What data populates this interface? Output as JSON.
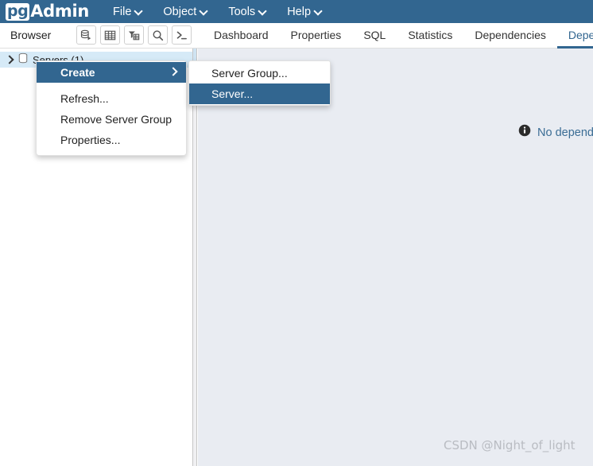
{
  "app": {
    "logo_pg": "pg",
    "logo_admin": "Admin"
  },
  "menubar": {
    "items": [
      {
        "label": "File",
        "icon": "chevron-down-icon"
      },
      {
        "label": "Object",
        "icon": "chevron-down-icon"
      },
      {
        "label": "Tools",
        "icon": "chevron-down-icon"
      },
      {
        "label": "Help",
        "icon": "chevron-down-icon"
      }
    ]
  },
  "browser_toolbar": {
    "title": "Browser",
    "buttons": [
      {
        "name": "object-explorer-icon"
      },
      {
        "name": "grid-table-icon"
      },
      {
        "name": "filter-table-icon"
      },
      {
        "name": "search-icon"
      },
      {
        "name": "query-terminal-icon"
      }
    ]
  },
  "tabs": {
    "items": [
      {
        "label": "Dashboard",
        "active": false
      },
      {
        "label": "Properties",
        "active": false
      },
      {
        "label": "SQL",
        "active": false
      },
      {
        "label": "Statistics",
        "active": false
      },
      {
        "label": "Dependencies",
        "active": false
      },
      {
        "label": "Dependents",
        "active": true
      }
    ]
  },
  "tree": {
    "root": {
      "label": "Servers (1)",
      "expand_icon": "chevron-right-icon",
      "node_icon": "server-group-icon"
    }
  },
  "context_menu": {
    "items": [
      {
        "label": "Create",
        "highlighted": true,
        "submenu_icon": "chevron-right-icon"
      },
      {
        "label": "Refresh...",
        "highlighted": false
      },
      {
        "label": "Remove Server Group",
        "highlighted": false
      },
      {
        "label": "Properties...",
        "highlighted": false
      }
    ]
  },
  "submenu": {
    "items": [
      {
        "label": "Server Group...",
        "highlighted": false
      },
      {
        "label": "Server...",
        "highlighted": true
      }
    ]
  },
  "content": {
    "info_icon": "info-icon",
    "message": "No dependents",
    "watermark": "CSDN @Night_of_light"
  },
  "colors": {
    "brand_blue": "#326690",
    "panel_bg": "#e9ecf2",
    "tree_selected": "#d6eaf7",
    "info_text": "#3b6d95",
    "watermark": "#b9bcc2"
  }
}
